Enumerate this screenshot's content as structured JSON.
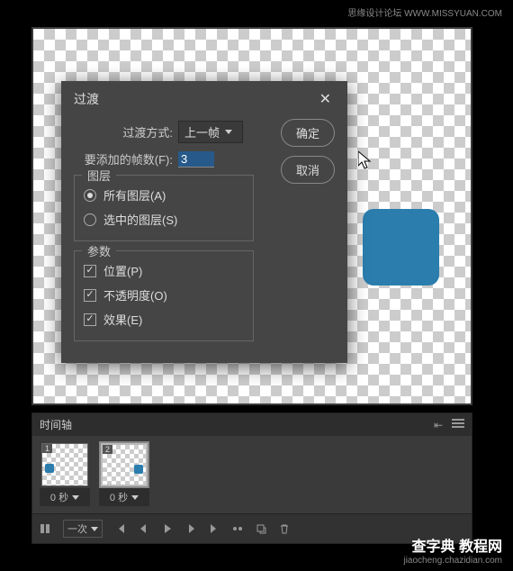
{
  "watermark_top": "思缘设计论坛 WWW.MISSYUAN.COM",
  "watermark_bottom_big": "查字典 教程网",
  "watermark_bottom_small": "jiaocheng.chazidian.com",
  "dialog": {
    "title": "过渡",
    "method_label": "过渡方式:",
    "method_value": "上一帧",
    "frames_label": "要添加的帧数(F):",
    "frames_value": "3",
    "layers_legend": "图层",
    "radio_all": "所有图层(A)",
    "radio_selected": "选中的图层(S)",
    "params_legend": "参数",
    "check_position": "位置(P)",
    "check_opacity": "不透明度(O)",
    "check_effect": "效果(E)",
    "ok": "确定",
    "cancel": "取消"
  },
  "timeline": {
    "title": "时间轴",
    "frames": [
      {
        "num": "1",
        "delay": "0 秒",
        "blue_pos": "left"
      },
      {
        "num": "2",
        "delay": "0 秒",
        "blue_pos": "right"
      }
    ],
    "loop": "一次"
  }
}
